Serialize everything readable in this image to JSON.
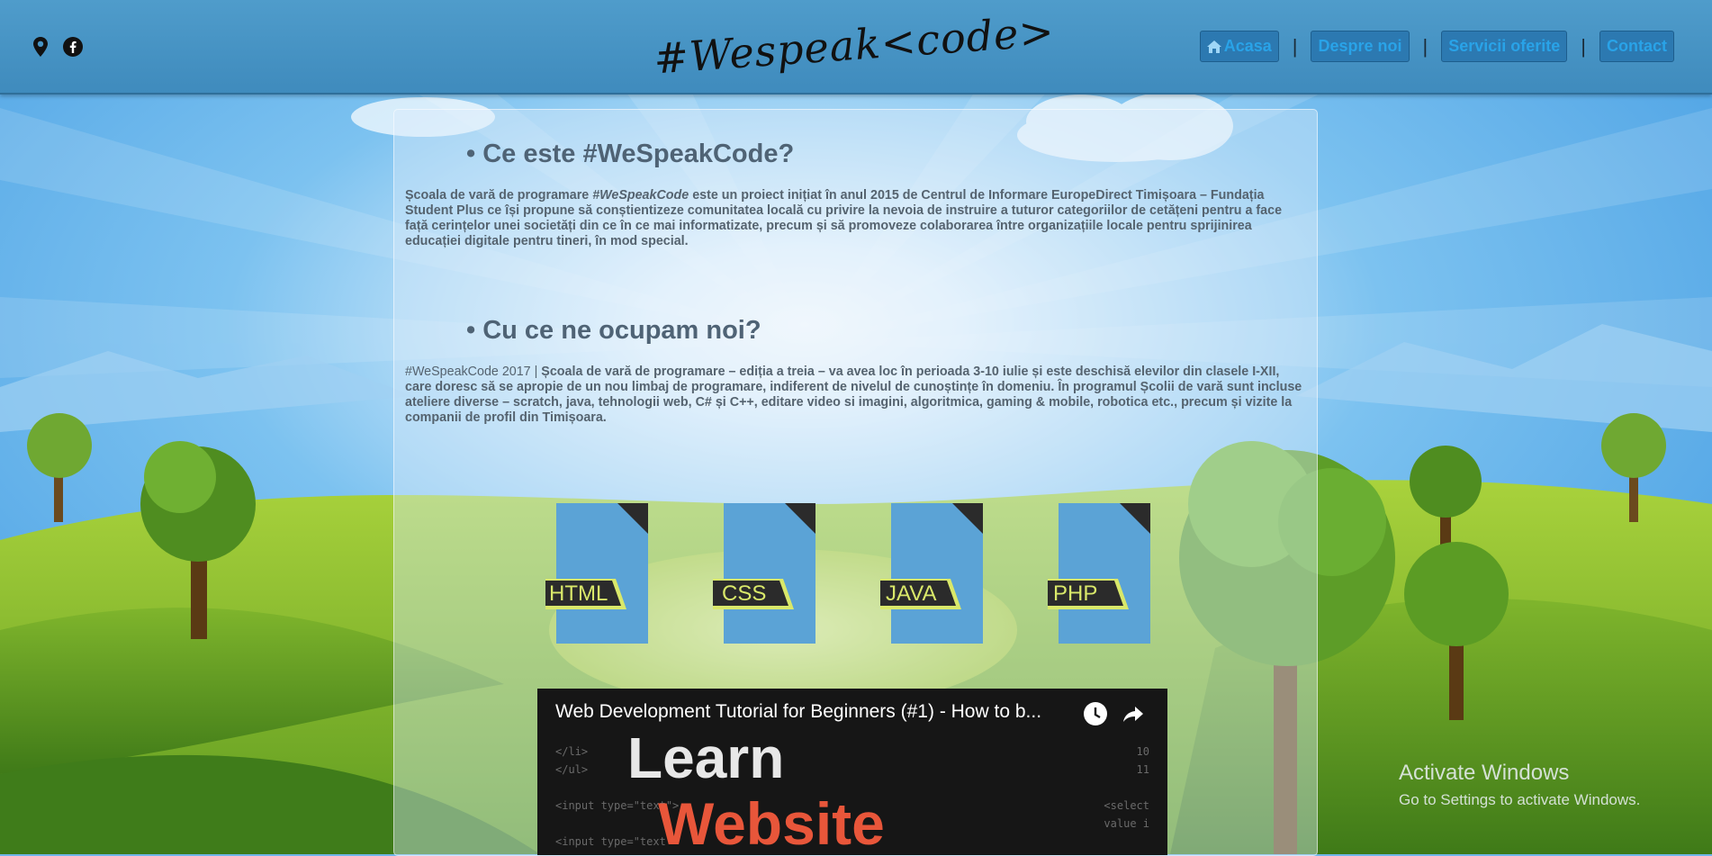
{
  "header": {
    "logo_text": "#Wespeak<code>",
    "social": [
      {
        "icon": "map-pin-icon"
      },
      {
        "icon": "facebook-icon"
      }
    ],
    "nav": [
      {
        "label": "Acasa",
        "icon": "home-icon"
      },
      {
        "label": "Despre noi"
      },
      {
        "label": "Servicii oferite"
      },
      {
        "label": "Contact"
      }
    ],
    "separator": "|"
  },
  "main": {
    "section1": {
      "title": "• Ce este #WeSpeakCode?",
      "text_prefix": "Școala de vară de programare ",
      "text_em": "#WeSpeakCode",
      "text_suffix": " este un proiect inițiat în anul 2015 de Centrul de Informare EuropeDirect Timișoara – Fundația Student Plus ce își propune să conștientizeze comunitatea locală cu privire la nevoia de instruire a tuturor categoriilor de cetățeni pentru a face față cerințelor unei societăți din ce în ce mai informatizate, precum și să promoveze colaborarea între organizațiile locale pentru sprijinirea educației digitale pentru tineri, în mod special."
    },
    "section2": {
      "title": "• Cu ce ne ocupam noi?",
      "text_prefix": "#WeSpeakCode 2017 | ",
      "text_bold": "Școala de vară de programare – ediția a treia – va avea loc în perioada 3-10 iulie și este deschisă elevilor din clasele I-XII, care doresc să se apropie de un nou limbaj de programare, indiferent de nivelul de cunoștințe în domeniu. În programul Școlii de vară sunt incluse ateliere diverse – scratch, java, tehnologii web, C# și C++, editare video si imagini, algoritmica, gaming & mobile, robotica etc., precum și vizite la companii de profil din Timișoara."
    },
    "file_icons": [
      {
        "label": "HTML"
      },
      {
        "label": "CSS"
      },
      {
        "label": "JAVA"
      },
      {
        "label": "PHP"
      }
    ],
    "video": {
      "title": "Web Development Tutorial for Beginners (#1) - How to b...",
      "thumb_line1": "Learn",
      "thumb_line2": "Website"
    }
  },
  "system": {
    "activate_title": "Activate Windows",
    "activate_subtitle": "Go to Settings to activate Windows."
  },
  "colors": {
    "header": "#4393c5",
    "nav_button": "#2c79b1",
    "nav_text": "#29a3e8",
    "file_blue": "#5ba3d6",
    "file_label_bg": "#2b2b2b",
    "file_label_text": "#d9e86a"
  }
}
